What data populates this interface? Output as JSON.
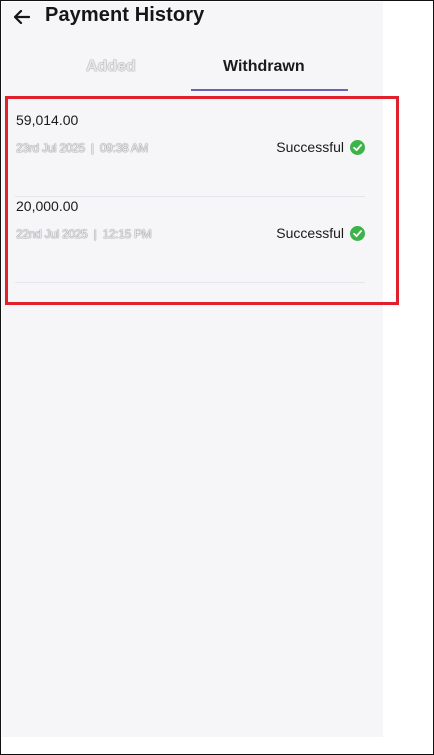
{
  "header": {
    "title": "Payment History",
    "back_icon": "arrow-left-icon"
  },
  "tabs": [
    {
      "label": "Added",
      "active": false
    },
    {
      "label": "Withdrawn",
      "active": true
    }
  ],
  "transactions": [
    {
      "amount": "59,014.00",
      "date": "23rd Jul 2025",
      "separator": "|",
      "time": "09:38 AM",
      "status": "Successful",
      "status_icon": "check-circle-icon"
    },
    {
      "amount": "20,000.00",
      "date": "22nd Jul 2025",
      "separator": "|",
      "time": "12:15 PM",
      "status": "Successful",
      "status_icon": "check-circle-icon"
    }
  ],
  "colors": {
    "accent": "#6b63b5",
    "success": "#3db44a",
    "highlight_border": "#e0202a"
  }
}
